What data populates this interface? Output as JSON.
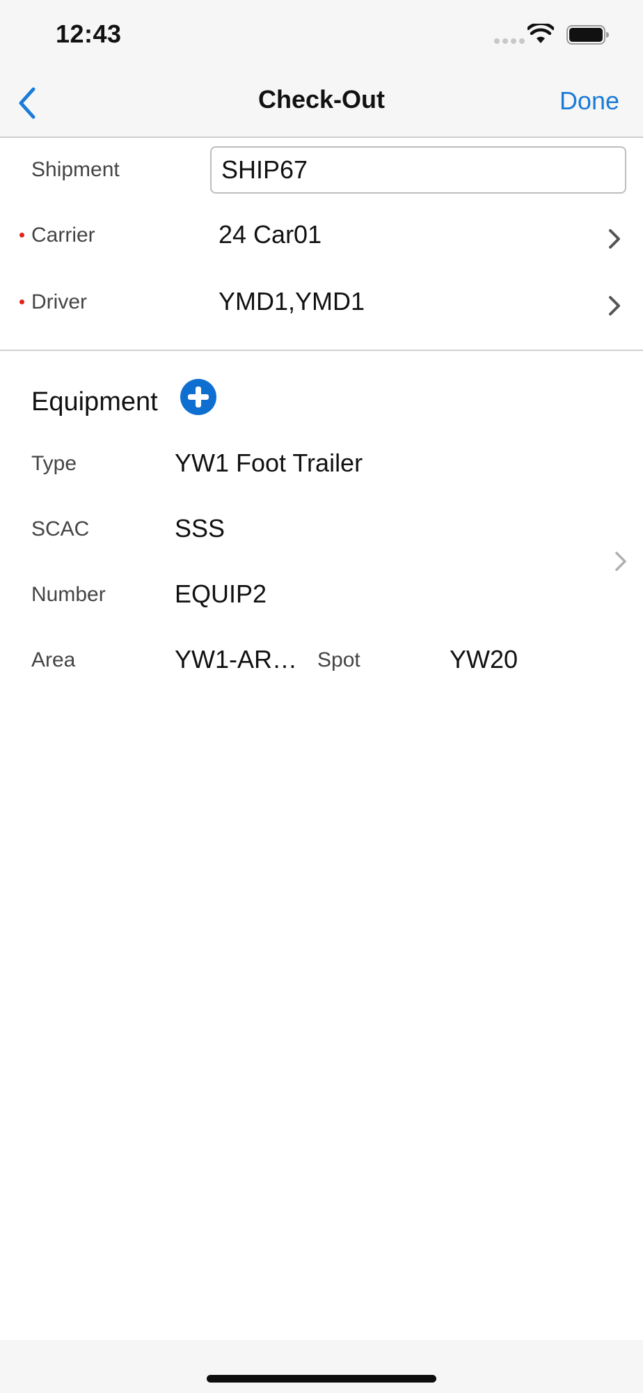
{
  "status_bar": {
    "time": "12:43"
  },
  "nav": {
    "title": "Check-Out",
    "done_label": "Done",
    "back_icon": "chevron-left-icon"
  },
  "form": {
    "shipment": {
      "label": "Shipment",
      "value": "SHIP67"
    },
    "carrier": {
      "label": "Carrier",
      "value": "24 Car01",
      "required": true
    },
    "driver": {
      "label": "Driver",
      "value": "YMD1,YMD1",
      "required": true
    }
  },
  "equipment": {
    "title": "Equipment",
    "add_icon": "plus-circle-icon",
    "item": {
      "type_label": "Type",
      "type_value": "YW1 Foot Trailer",
      "scac_label": "SCAC",
      "scac_value": "SSS",
      "number_label": "Number",
      "number_value": "EQUIP2",
      "area_label": "Area",
      "area_value": "YW1-AREA1",
      "spot_label": "Spot",
      "spot_value": "YW20"
    }
  },
  "colors": {
    "accent": "#1a7bd8",
    "add_button": "#0f6fd0",
    "required": "#e0241b",
    "bar_background": "#f6f6f6"
  }
}
